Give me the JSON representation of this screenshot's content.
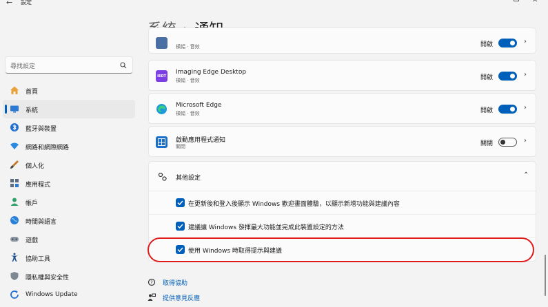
{
  "window": {
    "title": "設定"
  },
  "breadcrumb": {
    "parent": "系統",
    "current": "通知"
  },
  "search": {
    "placeholder": "尋找設定"
  },
  "sidebar": {
    "items": [
      {
        "label": "首頁",
        "icon": "home-icon"
      },
      {
        "label": "系統",
        "icon": "system-icon",
        "active": true
      },
      {
        "label": "藍牙與裝置",
        "icon": "bluetooth-icon"
      },
      {
        "label": "網路和網際網路",
        "icon": "wifi-icon"
      },
      {
        "label": "個人化",
        "icon": "brush-icon"
      },
      {
        "label": "應用程式",
        "icon": "apps-icon"
      },
      {
        "label": "帳戶",
        "icon": "account-icon"
      },
      {
        "label": "時間與語言",
        "icon": "globe-icon"
      },
      {
        "label": "遊戲",
        "icon": "gamepad-icon"
      },
      {
        "label": "協助工具",
        "icon": "accessibility-icon"
      },
      {
        "label": "隱私權與安全性",
        "icon": "shield-icon"
      },
      {
        "label": "Windows Update",
        "icon": "update-icon"
      }
    ]
  },
  "apps": [
    {
      "name": "",
      "sub": "橫幅 · 音效",
      "state": "開啟",
      "on": true
    },
    {
      "name": "Imaging Edge Desktop",
      "sub": "橫幅 · 音效",
      "state": "開啟",
      "on": true
    },
    {
      "name": "Microsoft Edge",
      "sub": "橫幅 · 音效",
      "state": "開啟",
      "on": true
    },
    {
      "name": "啟動應用程式通知",
      "sub": "關閉",
      "state": "關閉",
      "on": false
    }
  ],
  "app_icons": {
    "imaging_edge_text": "IEDT"
  },
  "other_settings": {
    "label": "其他設定",
    "options": [
      {
        "label": "在更新後和登入後顯示 Windows 歡迎畫面體驗，以顯示新增功能與建議內容",
        "checked": true
      },
      {
        "label": "建議讓 Windows 發揮最大功能並完成此裝置設定的方法",
        "checked": true
      },
      {
        "label": "使用 Windows 時取得提示與建議",
        "checked": true
      }
    ]
  },
  "links": {
    "help": "取得協助",
    "feedback": "提供意見反應"
  },
  "colors": {
    "accent": "#005fb8",
    "highlight_ring": "#e01919"
  }
}
